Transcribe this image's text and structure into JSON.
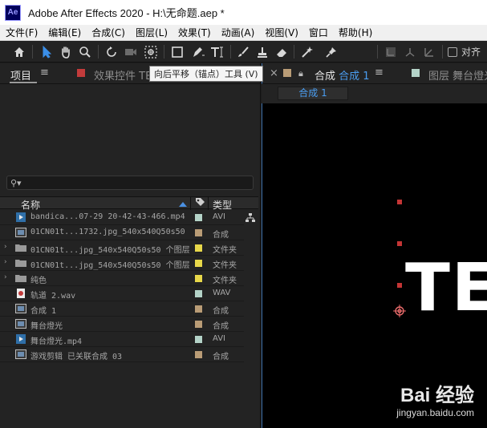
{
  "app": {
    "logo": "Ae",
    "title": "Adobe After Effects 2020 - H:\\无命题.aep *"
  },
  "menu": [
    "文件(F)",
    "编辑(E)",
    "合成(C)",
    "图层(L)",
    "效果(T)",
    "动画(A)",
    "视图(V)",
    "窗口",
    "帮助(H)"
  ],
  "toolbar": {
    "tools": [
      "home-icon",
      "selection-arrow-icon",
      "hand-icon",
      "zoom-icon",
      "rotate-icon",
      "camera-icon",
      "pan-behind-icon",
      "rectangle-icon",
      "pen-icon",
      "type-icon",
      "brush-icon",
      "clone-stamp-icon",
      "eraser-icon",
      "roto-brush-icon",
      "puppet-pin-icon"
    ],
    "snap_label": "对齐",
    "active_color": "#3b8fe8"
  },
  "tooltip": "向后平移（锚点）工具 (V)",
  "project_panel": {
    "tab_label": "项目",
    "effects_tab_label": "效果控件 TE",
    "columns": {
      "name": "名称",
      "type": "类型"
    },
    "search_placeholder": "",
    "items": [
      {
        "name": "bandica...07-29 20-42-43-466.mp4",
        "type": "AVI",
        "label_color": "#b4d3c8",
        "icon": "video-file-icon",
        "expand": ""
      },
      {
        "name": "01CN01t...1732.jpg_540x540Q50s50",
        "type": "合成",
        "label_color": "#b99c76",
        "icon": "composition-icon",
        "expand": ""
      },
      {
        "name": "01CN01t...jpg_540x540Q50s50 个图层",
        "type": "文件夹",
        "label_color": "#e8d84a",
        "icon": "folder-icon",
        "expand": "›"
      },
      {
        "name": "01CN01t...jpg_540x540Q50s50 个图层",
        "type": "文件夹",
        "label_color": "#e8d84a",
        "icon": "folder-icon",
        "expand": "›"
      },
      {
        "name": "纯色",
        "type": "文件夹",
        "label_color": "#e8d84a",
        "icon": "folder-icon",
        "expand": "›"
      },
      {
        "name": "轨道 2.wav",
        "type": "WAV",
        "label_color": "#b4d3c8",
        "icon": "audio-file-icon",
        "expand": ""
      },
      {
        "name": "合成 1",
        "type": "合成",
        "label_color": "#b99c76",
        "icon": "composition-icon",
        "expand": ""
      },
      {
        "name": "舞台燈光",
        "type": "合成",
        "label_color": "#b99c76",
        "icon": "composition-icon",
        "expand": ""
      },
      {
        "name": "舞台燈光.mp4",
        "type": "AVI",
        "label_color": "#b4d3c8",
        "icon": "video-file-icon",
        "expand": ""
      },
      {
        "name": "游戏剪辑 已关联合成 03",
        "type": "合成",
        "label_color": "#b99c76",
        "icon": "composition-icon",
        "expand": ""
      }
    ]
  },
  "composition_panel": {
    "close_glyph": "×",
    "tab_prefix": "合成",
    "tab_name": "合成 1",
    "layer_tab": "图层 舞台燈光",
    "subtab": "合成 1",
    "viewer_text": "TE"
  },
  "watermark": {
    "main": "Bai 经验",
    "sub": "jingyan.baidu.com"
  }
}
